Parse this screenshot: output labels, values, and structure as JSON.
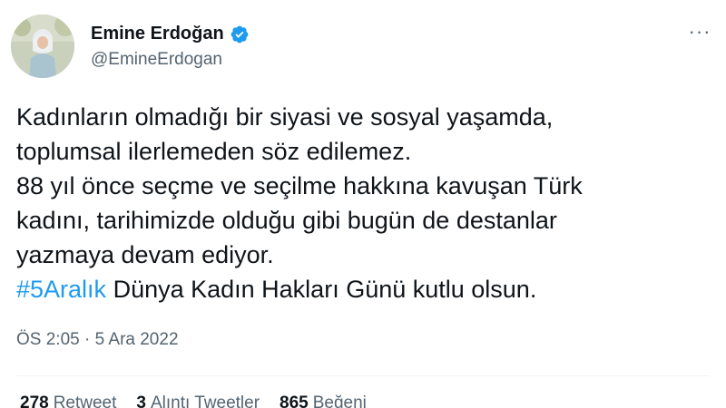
{
  "author": {
    "display_name": "Emine Erdoğan",
    "handle": "@EmineErdogan",
    "verified": true,
    "badge_color": "#1d9bf0"
  },
  "tweet": {
    "lines": [
      "Kadınların olmadığı bir siyasi ve sosyal yaşamda,",
      "toplumsal ilerlemeden söz edilemez.",
      "88 yıl önce seçme ve seçilme hakkına kavuşan Türk",
      "kadını, tarihimizde olduğu gibi bugün de destanlar",
      "yazmaya devam ediyor."
    ],
    "hashtag": "#5Aralık",
    "hashtag_color": "#1d9bf0",
    "last_line_rest": " Dünya Kadın Hakları Günü kutlu olsun."
  },
  "timestamp": "ÖS 2:05 · 5 Ara 2022",
  "more_icon": "more-horizontal-icon",
  "stats": {
    "retweets": {
      "count": "278",
      "label": "Retweet"
    },
    "quotes": {
      "count": "3",
      "label": "Alıntı Tweetler"
    },
    "likes": {
      "count": "865",
      "label": "Beğeni"
    }
  }
}
